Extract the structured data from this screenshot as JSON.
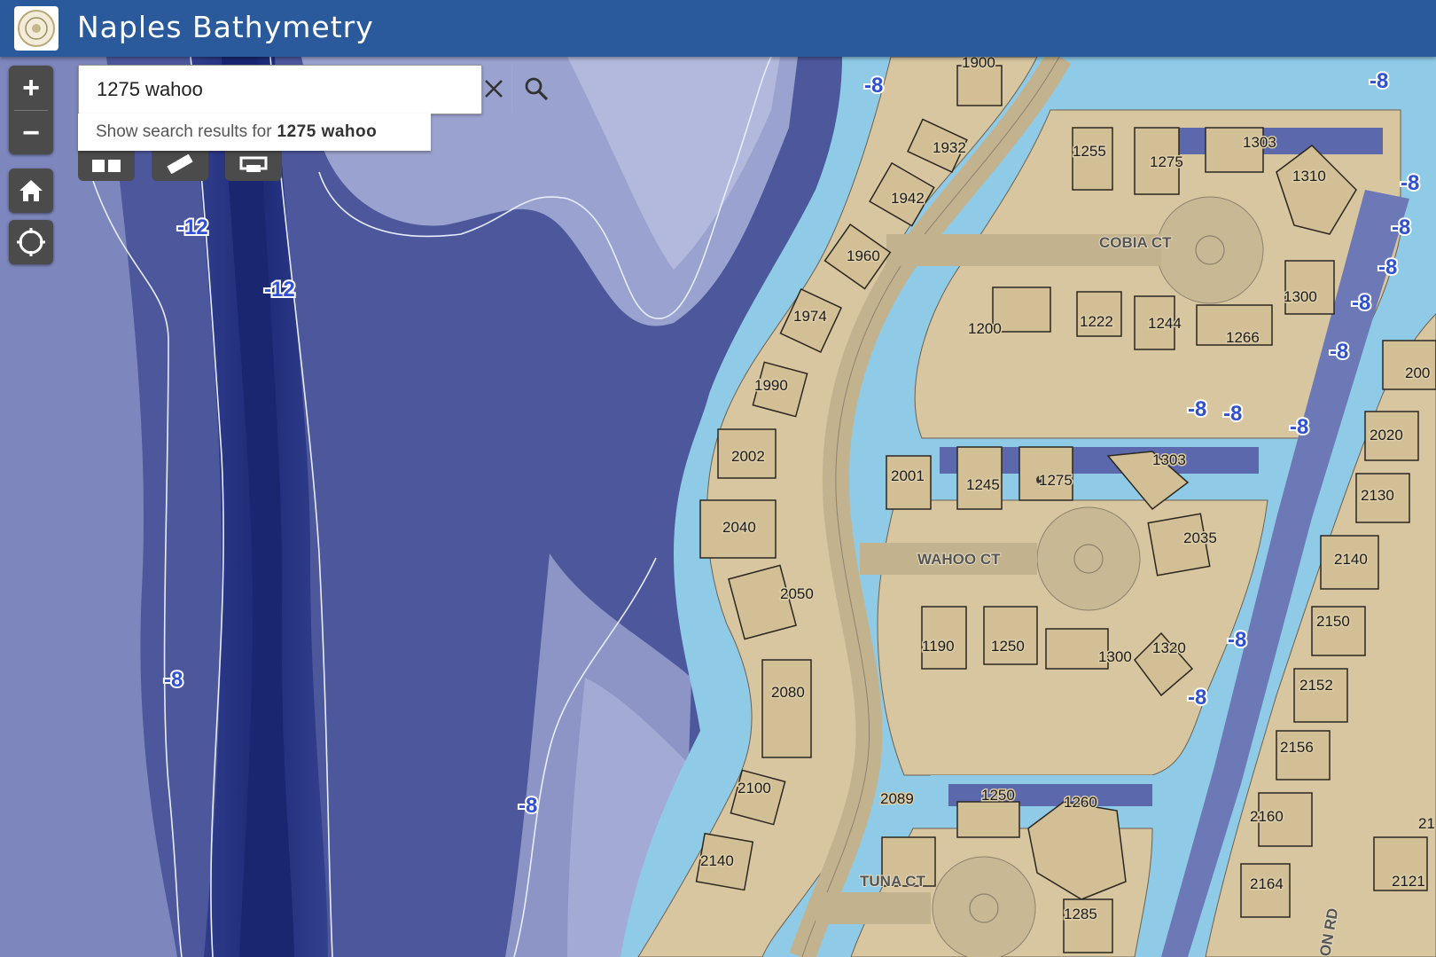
{
  "app": {
    "title": "Naples Bathymetry"
  },
  "search": {
    "value": "1275 wahoo",
    "suggestion_prefix": "Show search results for",
    "suggestion_term": "1275 wahoo"
  },
  "controls": {
    "zoom_in": "+",
    "zoom_out": "−",
    "home": "home-icon",
    "locate": "locate-icon"
  },
  "tools": [
    "basemap-gallery-icon",
    "measure-icon",
    "print-icon"
  ],
  "depth_labels": [
    "-12",
    "-12",
    "-8",
    "-8",
    "-8",
    "-8",
    "-8",
    "-8",
    "-8",
    "-8",
    "-8",
    "-8",
    "-8",
    "-8",
    "-8",
    "-8"
  ],
  "street_labels": [
    "COBIA CT",
    "WAHOO CT",
    "TUNA CT",
    "ON RD"
  ],
  "parcels": [
    "1900",
    "1932",
    "1942",
    "1960",
    "1974",
    "1990",
    "2002",
    "2040",
    "2050",
    "2080",
    "2100",
    "2140",
    "1255",
    "1275",
    "1303",
    "1310",
    "1300",
    "1266",
    "1244",
    "1222",
    "1200",
    "2001",
    "1245",
    "1275",
    "1303",
    "2035",
    "1320",
    "1300",
    "1250",
    "1190",
    "2089",
    "1250",
    "1260",
    "1285",
    "200",
    "2020",
    "2130",
    "2140",
    "2150",
    "2152",
    "2156",
    "2160",
    "2164",
    "2121",
    "21"
  ],
  "colors": {
    "header": "#2a5a9c",
    "deep_water": "#1f2f7c",
    "mid_water": "#4a5599",
    "shallow_water": "#8a93c6",
    "canal": "#8fcbe6",
    "land": "#d6c49e",
    "depth_label": "#3050d0"
  }
}
